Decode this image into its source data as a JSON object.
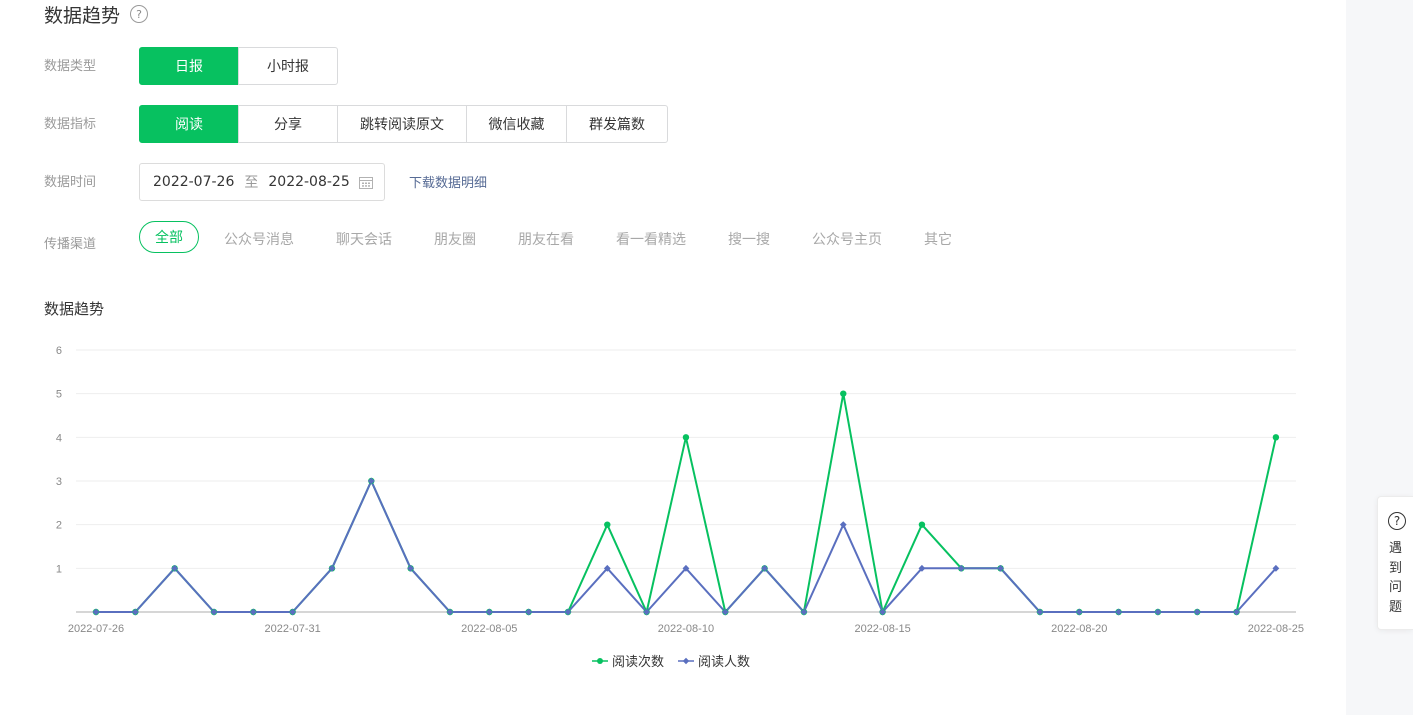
{
  "header": {
    "title": "数据趋势",
    "help_icon": "question-circle-icon",
    "help_glyph": "?"
  },
  "filters": {
    "type_label": "数据类型",
    "type_options": [
      "日报",
      "小时报"
    ],
    "metric_label": "数据指标",
    "metric_options": [
      "阅读",
      "分享",
      "跳转阅读原文",
      "微信收藏",
      "群发篇数"
    ],
    "time_label": "数据时间",
    "date_start": "2022-07-26",
    "date_sep": "至",
    "date_end": "2022-08-25",
    "calendar_icon": "calendar-icon",
    "download_label": "下载数据明细",
    "channel_label": "传播渠道",
    "channels": [
      "全部",
      "公众号消息",
      "聊天会话",
      "朋友圈",
      "朋友在看",
      "看一看精选",
      "搜一搜",
      "公众号主页",
      "其它"
    ]
  },
  "chart_section": {
    "title": "数据趋势"
  },
  "chart_data": {
    "type": "line",
    "x": [
      "2022-07-26",
      "2022-07-27",
      "2022-07-28",
      "2022-07-29",
      "2022-07-30",
      "2022-07-31",
      "2022-08-01",
      "2022-08-02",
      "2022-08-03",
      "2022-08-04",
      "2022-08-05",
      "2022-08-06",
      "2022-08-07",
      "2022-08-08",
      "2022-08-09",
      "2022-08-10",
      "2022-08-11",
      "2022-08-12",
      "2022-08-13",
      "2022-08-14",
      "2022-08-15",
      "2022-08-16",
      "2022-08-17",
      "2022-08-18",
      "2022-08-19",
      "2022-08-20",
      "2022-08-21",
      "2022-08-22",
      "2022-08-23",
      "2022-08-24",
      "2022-08-25"
    ],
    "x_tick_labels": [
      "2022-07-26",
      "2022-07-31",
      "2022-08-05",
      "2022-08-10",
      "2022-08-15",
      "2022-08-20",
      "2022-08-25"
    ],
    "y_ticks": [
      "1",
      "2",
      "3",
      "4",
      "5",
      "6"
    ],
    "ylim": [
      0,
      6
    ],
    "grid": true,
    "legend_position": "bottom-center",
    "series": [
      {
        "name": "阅读次数",
        "color": "#07c160",
        "marker": "circle",
        "values": [
          0,
          0,
          1,
          0,
          0,
          0,
          1,
          3,
          1,
          0,
          0,
          0,
          0,
          2,
          0,
          4,
          0,
          1,
          0,
          5,
          0,
          2,
          1,
          1,
          0,
          0,
          0,
          0,
          0,
          0,
          4
        ]
      },
      {
        "name": "阅读人数",
        "color": "#5a6fbf",
        "marker": "diamond",
        "values": [
          0,
          0,
          1,
          0,
          0,
          0,
          1,
          3,
          1,
          0,
          0,
          0,
          0,
          1,
          0,
          1,
          0,
          1,
          0,
          2,
          0,
          1,
          1,
          1,
          0,
          0,
          0,
          0,
          0,
          0,
          1
        ]
      }
    ]
  },
  "help_float": {
    "icon": "question-circle-icon",
    "glyph": "?",
    "label": "遇到问题"
  }
}
